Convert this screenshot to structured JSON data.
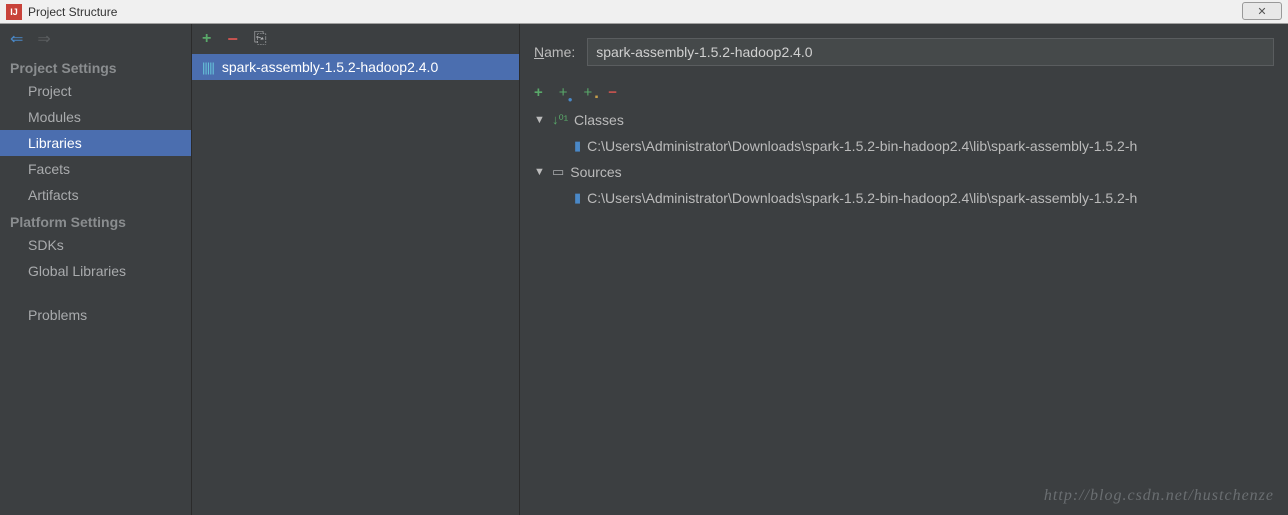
{
  "window": {
    "title": "Project Structure",
    "close_symbol": "✕"
  },
  "sidebar": {
    "sections": [
      {
        "title": "Project Settings",
        "items": [
          {
            "label": "Project",
            "selected": false
          },
          {
            "label": "Modules",
            "selected": false
          },
          {
            "label": "Libraries",
            "selected": true
          },
          {
            "label": "Facets",
            "selected": false
          },
          {
            "label": "Artifacts",
            "selected": false
          }
        ]
      },
      {
        "title": "Platform Settings",
        "items": [
          {
            "label": "SDKs",
            "selected": false
          },
          {
            "label": "Global Libraries",
            "selected": false
          }
        ]
      },
      {
        "title": "",
        "items": [
          {
            "label": "Problems",
            "selected": false
          }
        ]
      }
    ]
  },
  "libraries": {
    "selected": {
      "label": "spark-assembly-1.5.2-hadoop2.4.0"
    }
  },
  "detail": {
    "name_label_html": "Name:",
    "name_value": "spark-assembly-1.5.2-hadoop2.4.0",
    "tree": {
      "classes": {
        "label": "Classes",
        "path": "C:\\Users\\Administrator\\Downloads\\spark-1.5.2-bin-hadoop2.4\\lib\\spark-assembly-1.5.2-h"
      },
      "sources": {
        "label": "Sources",
        "path": "C:\\Users\\Administrator\\Downloads\\spark-1.5.2-bin-hadoop2.4\\lib\\spark-assembly-1.5.2-h"
      }
    }
  },
  "watermark": "http://blog.csdn.net/hustchenze"
}
